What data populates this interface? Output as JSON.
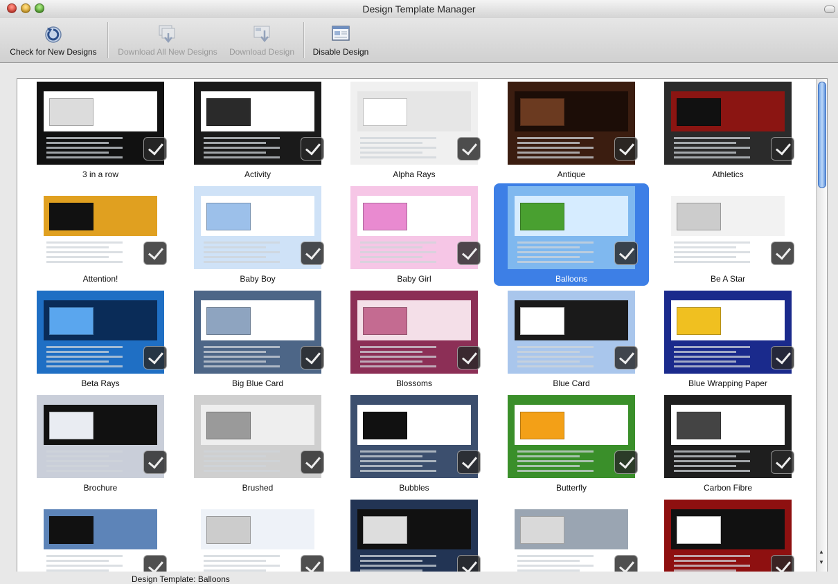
{
  "window": {
    "title": "Design Template Manager"
  },
  "toolbar": {
    "check": "Check for New Designs",
    "download_all": "Download All New Designs",
    "download": "Download Design",
    "disable": "Disable Design"
  },
  "designs": [
    {
      "name": "3 in a row",
      "bg": "#111111",
      "band": "#ffffff",
      "accent": "#dcdcdc"
    },
    {
      "name": "Activity",
      "bg": "#1a1a1a",
      "band": "#ffffff",
      "accent": "#2a2a2a"
    },
    {
      "name": "Alpha Rays",
      "bg": "#f0f0f0",
      "band": "#e6e6e6",
      "accent": "#ffffff"
    },
    {
      "name": "Antique",
      "bg": "#3b1d10",
      "band": "#1c0d07",
      "accent": "#6b3a20"
    },
    {
      "name": "Athletics",
      "bg": "#2b2b2b",
      "band": "#8b1512",
      "accent": "#111111"
    },
    {
      "name": "Attention!",
      "bg": "#ffffff",
      "band": "#e0a020",
      "accent": "#111111"
    },
    {
      "name": "Baby Boy",
      "bg": "#cfe2f7",
      "band": "#ffffff",
      "accent": "#9cc0ea"
    },
    {
      "name": "Baby Girl",
      "bg": "#f6c6e6",
      "band": "#ffffff",
      "accent": "#e98ad0"
    },
    {
      "name": "Balloons",
      "bg": "#7fb8ef",
      "band": "#d6ecff",
      "accent": "#49a030"
    },
    {
      "name": "Be A Star",
      "bg": "#ffffff",
      "band": "#f2f2f2",
      "accent": "#cccccc"
    },
    {
      "name": "Beta Rays",
      "bg": "#1f6fc4",
      "band": "#0a2c58",
      "accent": "#5aa6ee"
    },
    {
      "name": "Big Blue Card",
      "bg": "#4d6687",
      "band": "#ffffff",
      "accent": "#8ea4c0"
    },
    {
      "name": "Blossoms",
      "bg": "#8c2f56",
      "band": "#f4dfe8",
      "accent": "#c46b91"
    },
    {
      "name": "Blue Card",
      "bg": "#a9c6ec",
      "band": "#1a1a1a",
      "accent": "#ffffff"
    },
    {
      "name": "Blue Wrapping Paper",
      "bg": "#1a2a8c",
      "band": "#ffffff",
      "accent": "#f0c020"
    },
    {
      "name": "Brochure",
      "bg": "#c9ced9",
      "band": "#111111",
      "accent": "#e9ecf2"
    },
    {
      "name": "Brushed",
      "bg": "#cfcfcf",
      "band": "#eeeeee",
      "accent": "#9a9a9a"
    },
    {
      "name": "Bubbles",
      "bg": "#3c4f6e",
      "band": "#ffffff",
      "accent": "#111111"
    },
    {
      "name": "Butterfly",
      "bg": "#3a8f2a",
      "band": "#ffffff",
      "accent": "#f3a017"
    },
    {
      "name": "Carbon Fibre",
      "bg": "#1e1e1e",
      "band": "#ffffff",
      "accent": "#444444"
    },
    {
      "name": "",
      "bg": "#ffffff",
      "band": "#5d84b8",
      "accent": "#111111"
    },
    {
      "name": "",
      "bg": "#ffffff",
      "band": "#eef2f8",
      "accent": "#cccccc"
    },
    {
      "name": "",
      "bg": "#223454",
      "band": "#111111",
      "accent": "#dddddd"
    },
    {
      "name": "",
      "bg": "#ffffff",
      "band": "#9aa5b2",
      "accent": "#d9d9d9"
    },
    {
      "name": "",
      "bg": "#8e1010",
      "band": "#111111",
      "accent": "#ffffff"
    }
  ],
  "selected_index": 8,
  "status": {
    "text": "Design Template: Balloons"
  }
}
